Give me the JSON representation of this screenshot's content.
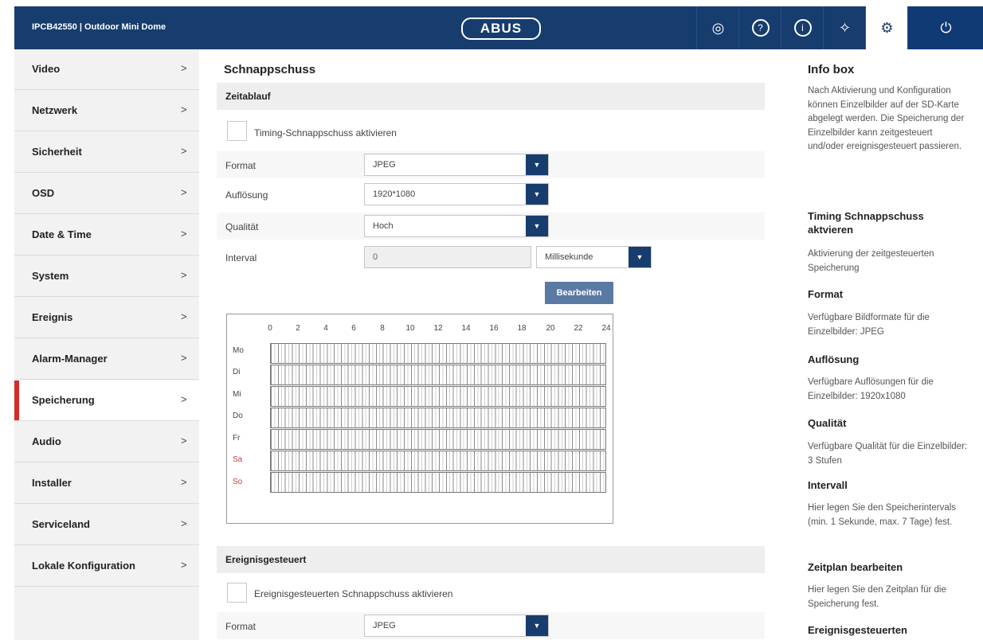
{
  "header": {
    "device_title": "IPCB42550  |  Outdoor Mini Dome",
    "logo_text": "ABUS",
    "toolbar_icons": [
      "live-view-icon",
      "help-icon",
      "info-icon",
      "wizard-icon",
      "settings-icon",
      "power-icon"
    ],
    "toolbar_glyphs": [
      "◎",
      "?",
      "i",
      "✧",
      "⚙",
      "⏻"
    ]
  },
  "sidebar": {
    "items": [
      {
        "label": "Video"
      },
      {
        "label": "Netzwerk"
      },
      {
        "label": "Sicherheit"
      },
      {
        "label": "OSD"
      },
      {
        "label": "Date & Time"
      },
      {
        "label": "System"
      },
      {
        "label": "Ereignis"
      },
      {
        "label": "Alarm-Manager"
      },
      {
        "label": "Speicherung"
      },
      {
        "label": "Audio"
      },
      {
        "label": "Installer"
      },
      {
        "label": "Serviceland"
      },
      {
        "label": "Lokale Konfiguration"
      }
    ],
    "active": "Speicherung",
    "chevron": ">",
    "accent_color": "#d62b2b"
  },
  "main": {
    "title": "Schnappschuss",
    "timing": {
      "section_title": "Zeitablauf",
      "enable_label": "Timing-Schnappschuss aktivieren",
      "format": {
        "label": "Format",
        "value": "JPEG"
      },
      "resolution": {
        "label": "Auflösung",
        "value": "1920*1080"
      },
      "quality": {
        "label": "Qualität",
        "value": "Hoch"
      },
      "interval": {
        "label": "Interval",
        "value": "0",
        "unit": "Millisekunde"
      },
      "edit_button": "Bearbeiten"
    },
    "schedule": {
      "hours": [
        "0",
        "2",
        "4",
        "6",
        "8",
        "10",
        "12",
        "14",
        "16",
        "18",
        "20",
        "22",
        "24"
      ],
      "days": [
        "Mo",
        "Di",
        "Mi",
        "Do",
        "Fr",
        "Sa",
        "So"
      ],
      "weekend_color": "#c84040"
    },
    "event": {
      "section_title": "Ereignisgesteuert",
      "enable_label": "Ereignisgesteuerten Schnappschuss aktivieren",
      "format": {
        "label": "Format",
        "value": "JPEG"
      }
    }
  },
  "infobox": {
    "title": "Info box",
    "intro": "Nach Aktivierung und Konfiguration können Einzelbilder auf der SD-Karte abgelegt werden. Die Speicherung der Einzelbilder kann zeitgesteuert und/oder ereignisgesteuert passieren.",
    "sections": [
      {
        "heading": "Timing Schnappschuss aktvieren",
        "text": "Aktivierung der zeitgesteuerten Speicherung"
      },
      {
        "heading": "Format",
        "text": "Verfügbare Bildformate für die Einzelbilder: JPEG"
      },
      {
        "heading": "Auflösung",
        "text": "Verfügbare Auflösungen für die Einzelbilder: 1920x1080"
      },
      {
        "heading": "Qualität",
        "text": "Verfügbare Qualität für die Einzelbilder: 3 Stufen"
      },
      {
        "heading": "Intervall",
        "text": "Hier legen Sie den Speicherintervals (min. 1 Sekunde, max. 7 Tage) fest."
      },
      {
        "heading": "Zeitplan bearbeiten",
        "text": "Hier legen Sie den Zeitplan für die Speicherung fest."
      },
      {
        "heading": "Ereignisgesteuerten",
        "text": ""
      }
    ]
  },
  "colors": {
    "header_bg": "#173d6e",
    "accent_red": "#d62b2b",
    "button_blue": "#5a79a3"
  }
}
